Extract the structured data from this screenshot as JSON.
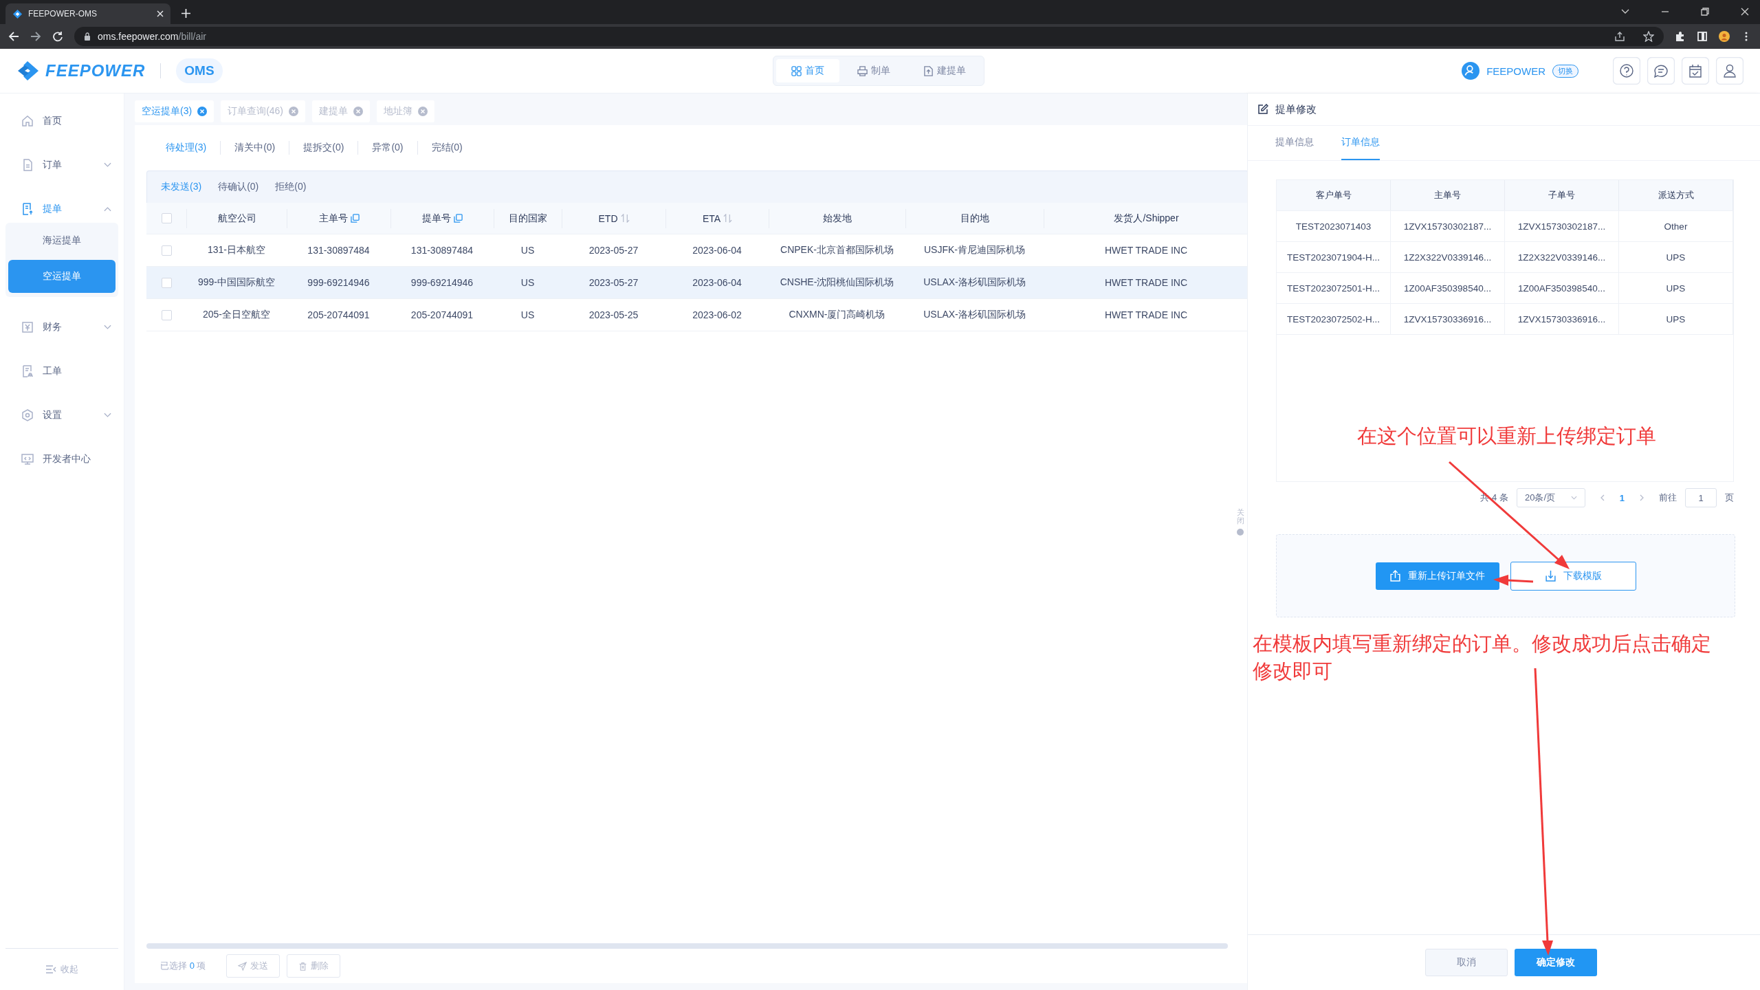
{
  "browser": {
    "tab_title": "FEEPOWER-OMS",
    "url_host": "oms.feepower.com",
    "url_path": "/bill/air"
  },
  "header": {
    "brand": "FEEPOWER",
    "product": "OMS",
    "nav": [
      {
        "label": "首页",
        "selected": true
      },
      {
        "label": "制单",
        "selected": false
      },
      {
        "label": "建提单",
        "selected": false
      }
    ],
    "user": {
      "name": "FEEPOWER",
      "switch": "切换"
    }
  },
  "sidebar": {
    "items": [
      {
        "label": "首页",
        "kind": "link",
        "selected": false
      },
      {
        "label": "订单",
        "kind": "group",
        "selected": false,
        "expanded": false
      },
      {
        "label": "提单",
        "kind": "group",
        "selected": true,
        "expanded": true,
        "children": [
          {
            "label": "海运提单",
            "selected": false
          },
          {
            "label": "空运提单",
            "selected": true
          }
        ]
      },
      {
        "label": "财务",
        "kind": "group",
        "selected": false,
        "expanded": false
      },
      {
        "label": "工单",
        "kind": "link",
        "selected": false
      },
      {
        "label": "设置",
        "kind": "group",
        "selected": false,
        "expanded": false
      },
      {
        "label": "开发者中心",
        "kind": "link",
        "selected": false
      }
    ],
    "collapse": "收起"
  },
  "page_tabs": [
    {
      "label": "空运提单(3)",
      "selected": true
    },
    {
      "label": "订单查询(46)",
      "selected": false
    },
    {
      "label": "建提单",
      "selected": false
    },
    {
      "label": "地址簿",
      "selected": false
    }
  ],
  "status_tabs": [
    {
      "label": "待处理(3)",
      "selected": true
    },
    {
      "label": "清关中(0)",
      "selected": false
    },
    {
      "label": "提拆交(0)",
      "selected": false
    },
    {
      "label": "异常(0)",
      "selected": false
    },
    {
      "label": "完结(0)",
      "selected": false
    }
  ],
  "sub_tabs": [
    {
      "label": "未发送(3)",
      "selected": true
    },
    {
      "label": "待确认(0)",
      "selected": false
    },
    {
      "label": "拒绝(0)",
      "selected": false
    }
  ],
  "table": {
    "select_all": {
      "checked": false
    },
    "columns": [
      {
        "label": "航空公司",
        "kind": "plain"
      },
      {
        "label": "主单号",
        "kind": "copy"
      },
      {
        "label": "提单号",
        "kind": "copy"
      },
      {
        "label": "目的国家",
        "kind": "plain"
      },
      {
        "label": "ETD",
        "kind": "sort"
      },
      {
        "label": "ETA",
        "kind": "sort"
      },
      {
        "label": "始发地",
        "kind": "plain"
      },
      {
        "label": "目的地",
        "kind": "plain"
      },
      {
        "label": "发货人/Shipper",
        "kind": "plain"
      }
    ],
    "rows": [
      {
        "checked": false,
        "selected": false,
        "cells": [
          "131-日本航空",
          "131-30897484",
          "131-30897484",
          "US",
          "2023-05-27",
          "2023-06-04",
          "CNPEK-北京首都国际机场",
          "USJFK-肯尼迪国际机场",
          "HWET TRADE INC"
        ]
      },
      {
        "checked": false,
        "selected": true,
        "cells": [
          "999-中国国际航空",
          "999-69214946",
          "999-69214946",
          "US",
          "2023-05-27",
          "2023-06-04",
          "CNSHE-沈阳桃仙国际机场",
          "USLAX-洛杉矶国际机场",
          "HWET TRADE INC"
        ]
      },
      {
        "checked": false,
        "selected": false,
        "cells": [
          "205-全日空航空",
          "205-20744091",
          "205-20744091",
          "US",
          "2023-05-25",
          "2023-06-02",
          "CNXMN-厦门高崎机场",
          "USLAX-洛杉矶国际机场",
          "HWET TRADE INC"
        ]
      }
    ]
  },
  "footer": {
    "selected_prefix": "已选择",
    "selected_count": "0",
    "selected_suffix": "项",
    "actions": [
      {
        "label": "发送",
        "kind": "send",
        "disabled": true
      },
      {
        "label": "删除",
        "kind": "delete",
        "disabled": true
      }
    ]
  },
  "close_handle": "关闭",
  "panel": {
    "title": "提单修改",
    "tabs": [
      {
        "label": "提单信息",
        "selected": false
      },
      {
        "label": "订单信息",
        "selected": true
      }
    ],
    "columns": [
      "客户单号",
      "主单号",
      "子单号",
      "派送方式"
    ],
    "rows": [
      [
        "TEST2023071403",
        "1ZVX15730302187...",
        "1ZVX15730302187...",
        "Other"
      ],
      [
        "TEST2023071904-H...",
        "1Z2X322V0339146...",
        "1Z2X322V0339146...",
        "UPS"
      ],
      [
        "TEST2023072501-H...",
        "1Z00AF350398540...",
        "1Z00AF350398540...",
        "UPS"
      ],
      [
        "TEST2023072502-H...",
        "1ZVX15730336916...",
        "1ZVX15730336916...",
        "UPS"
      ]
    ],
    "pagination": {
      "total": "共 4 条",
      "page_size": "20条/页",
      "pages": [
        {
          "label": "1",
          "selected": true
        }
      ],
      "goto_label": "前往",
      "goto_value": "1",
      "goto_suffix": "页"
    },
    "upload_button": "重新上传订单文件",
    "download_button": "下载模版",
    "cancel_button": "取消",
    "confirm_button": "确定修改"
  },
  "annotations": [
    {
      "text": "在这个位置可以重新上传绑定订单"
    },
    {
      "text": "在模板内填写重新绑定的订单。修改成功后点击确定修改即可"
    }
  ]
}
